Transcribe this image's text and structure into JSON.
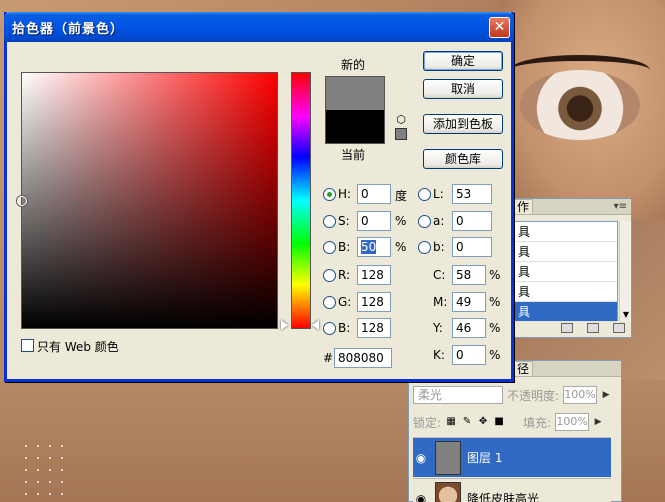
{
  "dialog": {
    "title": "拾色器（前景色）",
    "close_glyph": "✕",
    "new_label": "新的",
    "current_label": "当前",
    "buttons": {
      "ok": "确定",
      "cancel": "取消",
      "add_to_swatches": "添加到色板",
      "color_libraries": "颜色库"
    },
    "hsb": {
      "h": {
        "label": "H:",
        "value": "0",
        "unit": "度"
      },
      "s": {
        "label": "S:",
        "value": "0",
        "unit": "%"
      },
      "b": {
        "label": "B:",
        "value": "50",
        "unit": "%"
      }
    },
    "rgb": {
      "r": {
        "label": "R:",
        "value": "128"
      },
      "g": {
        "label": "G:",
        "value": "128"
      },
      "b": {
        "label": "B:",
        "value": "128"
      }
    },
    "lab": {
      "l": {
        "label": "L:",
        "value": "53"
      },
      "a": {
        "label": "a:",
        "value": "0"
      },
      "b": {
        "label": "b:",
        "value": "0"
      }
    },
    "cmyk": {
      "c": {
        "label": "C:",
        "value": "58",
        "unit": "%"
      },
      "m": {
        "label": "M:",
        "value": "49",
        "unit": "%"
      },
      "y": {
        "label": "Y:",
        "value": "46",
        "unit": "%"
      },
      "k": {
        "label": "K:",
        "value": "0",
        "unit": "%"
      }
    },
    "hex": {
      "label": "#",
      "value": "808080"
    },
    "web_only_label": "只有 Web 颜色",
    "new_color": "#808080",
    "current_color": "#000000",
    "selected_radio": "H"
  },
  "actions_panel": {
    "tab": "作",
    "rows": [
      "具",
      "具",
      "具",
      "具",
      "具"
    ],
    "selected_index": 4
  },
  "layers_panel": {
    "tab": "径",
    "blend_mode": "柔光",
    "opacity_label": "不透明度:",
    "opacity_value": "100%",
    "lock_label": "锁定:",
    "fill_label": "填充:",
    "fill_value": "100%",
    "layers": [
      {
        "name": "图层 1",
        "selected": true
      },
      {
        "name": "降低皮肤高光",
        "selected": false
      }
    ]
  }
}
